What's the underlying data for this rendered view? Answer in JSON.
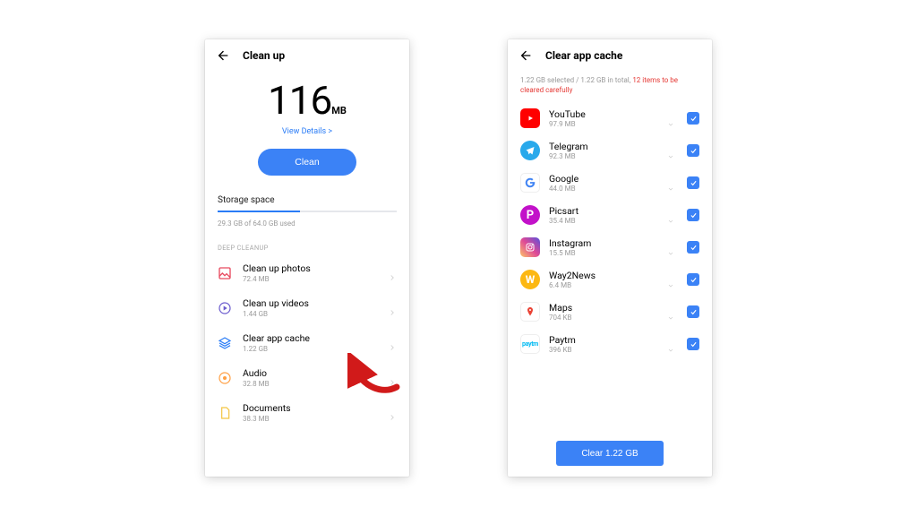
{
  "left": {
    "title": "Clean up",
    "big_number": "116",
    "big_unit": "MB",
    "view_details": "View Details >",
    "clean_button": "Clean",
    "storage_label": "Storage space",
    "storage_sub": "29.3 GB of 64.0 GB used",
    "deep_label": "DEEP CLEANUP",
    "items": [
      {
        "title": "Clean up photos",
        "sub": "72.4 MB",
        "icon": "photos-icon",
        "color": "#e84a5f"
      },
      {
        "title": "Clean up videos",
        "sub": "1.44 GB",
        "icon": "videos-icon",
        "color": "#6a5acd"
      },
      {
        "title": "Clear app cache",
        "sub": "1.22 GB",
        "icon": "cache-icon",
        "color": "#2a7cf6"
      },
      {
        "title": "Audio",
        "sub": "32.8 MB",
        "icon": "audio-icon",
        "color": "#ff9f43"
      },
      {
        "title": "Documents",
        "sub": "38.3 MB",
        "icon": "docs-icon",
        "color": "#f4c542"
      }
    ]
  },
  "right": {
    "title": "Clear app cache",
    "status_prefix": "1.22 GB selected / 1.22 GB in total, ",
    "status_warn": "12 items to be cleared carefully",
    "clear_button": "Clear 1.22 GB",
    "apps": [
      {
        "name": "YouTube",
        "size": "97.9 MB",
        "icon": "youtube-icon",
        "bg": "#ff0000",
        "shape": "rounded"
      },
      {
        "name": "Telegram",
        "size": "92.3 MB",
        "icon": "telegram-icon",
        "bg": "#29a9eb",
        "shape": "circle"
      },
      {
        "name": "Google",
        "size": "44.0 MB",
        "icon": "google-icon",
        "bg": "#ffffff",
        "shape": "rounded"
      },
      {
        "name": "Picsart",
        "size": "35.4 MB",
        "icon": "picsart-icon",
        "bg": "#c211c9",
        "shape": "circle"
      },
      {
        "name": "Instagram",
        "size": "15.5 MB",
        "icon": "instagram-icon",
        "bg": "linear-gradient(45deg,#fdc468,#df4996,#5851db)",
        "shape": "rounded"
      },
      {
        "name": "Way2News",
        "size": "6.4 MB",
        "icon": "way2news-icon",
        "bg": "#fcb813",
        "shape": "circle"
      },
      {
        "name": "Maps",
        "size": "704 KB",
        "icon": "maps-icon",
        "bg": "#ffffff",
        "shape": "rounded"
      },
      {
        "name": "Paytm",
        "size": "396 KB",
        "icon": "paytm-icon",
        "bg": "#ffffff",
        "shape": "rounded"
      }
    ]
  }
}
